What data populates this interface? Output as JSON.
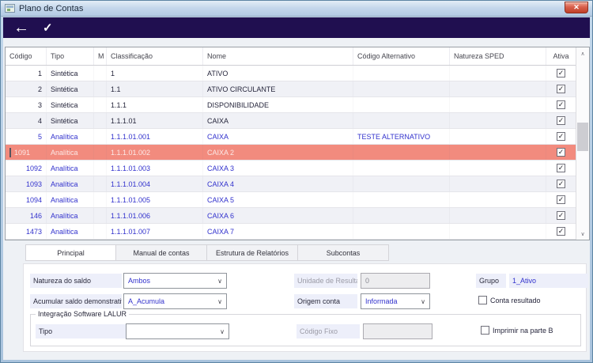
{
  "window": {
    "title": "Plano de Contas"
  },
  "icons": {
    "back": "←",
    "confirm": "✓",
    "close": "✕",
    "combo_chevron": "∨",
    "check": "✓",
    "scroll_up": "∧",
    "scroll_down": "∨"
  },
  "colors": {
    "toolbar_bg": "#200f50",
    "selected_row_bg": "#f28b7e",
    "analytic_text": "#3232cd",
    "label_bg": "#edeffa"
  },
  "table": {
    "columns": [
      "Código",
      "Tipo",
      "M",
      "Classificação",
      "Nome",
      "Código Alternativo",
      "Natureza SPED",
      "Ativa"
    ],
    "rows": [
      {
        "codigo": "1",
        "tipo": "Sintética",
        "m": "",
        "classificacao": "1",
        "nome": "ATIVO",
        "codigo_alternativo": "",
        "natureza_sped": "",
        "ativa": true,
        "kind": "sintetica",
        "selected": false
      },
      {
        "codigo": "2",
        "tipo": "Sintética",
        "m": "",
        "classificacao": "1.1",
        "nome": "ATIVO CIRCULANTE",
        "codigo_alternativo": "",
        "natureza_sped": "",
        "ativa": true,
        "kind": "sintetica",
        "selected": false
      },
      {
        "codigo": "3",
        "tipo": "Sintética",
        "m": "",
        "classificacao": "1.1.1",
        "nome": "DISPONIBILIDADE",
        "codigo_alternativo": "",
        "natureza_sped": "",
        "ativa": true,
        "kind": "sintetica",
        "selected": false
      },
      {
        "codigo": "4",
        "tipo": "Sintética",
        "m": "",
        "classificacao": "1.1.1.01",
        "nome": "CAIXA",
        "codigo_alternativo": "",
        "natureza_sped": "",
        "ativa": true,
        "kind": "sintetica",
        "selected": false
      },
      {
        "codigo": "5",
        "tipo": "Analítica",
        "m": "",
        "classificacao": "1.1.1.01.001",
        "nome": "CAIXA",
        "codigo_alternativo": "TESTE ALTERNATIVO",
        "natureza_sped": "",
        "ativa": true,
        "kind": "analitica",
        "selected": false
      },
      {
        "codigo": "1091",
        "tipo": "Analítica",
        "m": "",
        "classificacao": "1.1.1.01.002",
        "nome": "CAIXA 2",
        "codigo_alternativo": "",
        "natureza_sped": "",
        "ativa": true,
        "kind": "analitica",
        "selected": true
      },
      {
        "codigo": "1092",
        "tipo": "Analítica",
        "m": "",
        "classificacao": "1.1.1.01.003",
        "nome": "CAIXA 3",
        "codigo_alternativo": "",
        "natureza_sped": "",
        "ativa": true,
        "kind": "analitica",
        "selected": false
      },
      {
        "codigo": "1093",
        "tipo": "Analítica",
        "m": "",
        "classificacao": "1.1.1.01.004",
        "nome": "CAIXA 4",
        "codigo_alternativo": "",
        "natureza_sped": "",
        "ativa": true,
        "kind": "analitica",
        "selected": false
      },
      {
        "codigo": "1094",
        "tipo": "Analítica",
        "m": "",
        "classificacao": "1.1.1.01.005",
        "nome": "CAIXA 5",
        "codigo_alternativo": "",
        "natureza_sped": "",
        "ativa": true,
        "kind": "analitica",
        "selected": false
      },
      {
        "codigo": "146",
        "tipo": "Analítica",
        "m": "",
        "classificacao": "1.1.1.01.006",
        "nome": "CAIXA 6",
        "codigo_alternativo": "",
        "natureza_sped": "",
        "ativa": true,
        "kind": "analitica",
        "selected": false
      },
      {
        "codigo": "1473",
        "tipo": "Analítica",
        "m": "",
        "classificacao": "1.1.1.01.007",
        "nome": "CAIXA 7",
        "codigo_alternativo": "",
        "natureza_sped": "",
        "ativa": true,
        "kind": "analitica",
        "selected": false
      }
    ]
  },
  "tabs": [
    {
      "label": "Principal",
      "active": true
    },
    {
      "label": "Manual de contas",
      "active": false
    },
    {
      "label": "Estrutura de Relatórios",
      "active": false
    },
    {
      "label": "Subcontas",
      "active": false
    }
  ],
  "form": {
    "natureza_do_saldo": {
      "label": "Natureza do saldo",
      "value": "Ambos"
    },
    "acumular_saldo": {
      "label": "Acumular saldo demonstrativo",
      "value": "A_Acumula"
    },
    "unidade_resultado": {
      "label": "Unidade de Resultado",
      "value": "0"
    },
    "origem_conta": {
      "label": "Origem conta",
      "value": "Informada"
    },
    "grupo": {
      "label": "Grupo",
      "value": "1_Ativo"
    },
    "conta_resultado": {
      "label": "Conta resultado",
      "checked": false
    },
    "lalur": {
      "legend": "Integração Software LALUR",
      "tipo": {
        "label": "Tipo",
        "value": ""
      },
      "codigo_fixo": {
        "label": "Código Fixo",
        "value": ""
      },
      "imprimir_parte_b": {
        "label": "Imprimir na parte B",
        "checked": false
      }
    }
  }
}
